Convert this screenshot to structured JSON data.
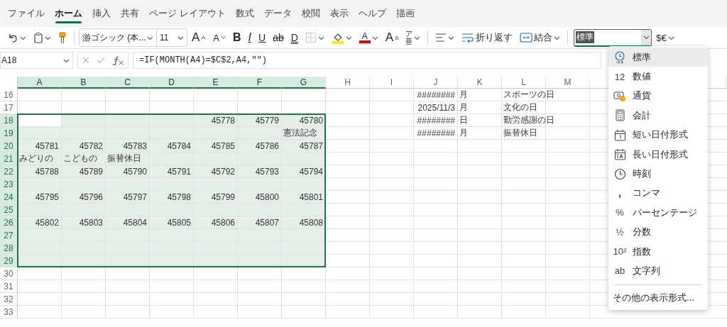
{
  "ribbon_tabs": [
    {
      "label": "ファイル",
      "selected": false
    },
    {
      "label": "ホーム",
      "selected": true
    },
    {
      "label": "挿入",
      "selected": false
    },
    {
      "label": "共有",
      "selected": false
    },
    {
      "label": "ページ レイアウト",
      "selected": false
    },
    {
      "label": "数式",
      "selected": false
    },
    {
      "label": "データ",
      "selected": false
    },
    {
      "label": "校閲",
      "selected": false
    },
    {
      "label": "表示",
      "selected": false
    },
    {
      "label": "ヘルプ",
      "selected": false
    },
    {
      "label": "描画",
      "selected": false
    }
  ],
  "toolbar": {
    "font": "游ゴシック (本...",
    "font_size": "11",
    "grow_font": "A",
    "shrink_font": "A",
    "bold": "B",
    "italic": "I",
    "underline": "U",
    "strikethrough": "ab",
    "double_underline": "D",
    "font_color": "A",
    "superscript_base": "A",
    "superscript_mark": "a",
    "phonetic_top": "ア",
    "phonetic_bottom": "亜",
    "wrap": "折り返す",
    "merge": "結合",
    "number_format": "標準",
    "currency": "$€"
  },
  "formula_bar": {
    "name_box": "A18",
    "formula": "=IF(MONTH(A4)=$C$2,A4,\"\")"
  },
  "sheet": {
    "columns": [
      {
        "label": "A",
        "selected": true
      },
      {
        "label": "B",
        "selected": true
      },
      {
        "label": "C",
        "selected": true
      },
      {
        "label": "D",
        "selected": true
      },
      {
        "label": "E",
        "selected": true
      },
      {
        "label": "F",
        "selected": true
      },
      {
        "label": "G",
        "selected": true
      },
      {
        "label": "H",
        "selected": false
      },
      {
        "label": "I",
        "selected": false
      },
      {
        "label": "J",
        "selected": false
      },
      {
        "label": "K",
        "selected": false
      },
      {
        "label": "L",
        "selected": false
      },
      {
        "label": "M",
        "selected": false
      }
    ],
    "rows": [
      {
        "number": "16",
        "selected": false,
        "cells": [
          {},
          {},
          {},
          {},
          {},
          {},
          {},
          {},
          {},
          {
            "text": "########",
            "kind": "number"
          },
          {
            "text": "月",
            "kind": "text"
          },
          {
            "text": "スポーツの日",
            "kind": "text"
          },
          {}
        ]
      },
      {
        "number": "17",
        "selected": false,
        "cells": [
          {},
          {},
          {},
          {},
          {},
          {},
          {},
          {},
          {},
          {
            "text": "2025/11/3",
            "kind": "number"
          },
          {
            "text": "月",
            "kind": "text"
          },
          {
            "text": "文化の日",
            "kind": "text"
          },
          {}
        ]
      },
      {
        "number": "18",
        "selected": true,
        "cells": [
          {
            "active": true
          },
          {},
          {},
          {},
          {
            "text": "45778",
            "kind": "number"
          },
          {
            "text": "45779",
            "kind": "number"
          },
          {
            "text": "45780",
            "kind": "number"
          },
          {},
          {},
          {
            "text": "########",
            "kind": "number"
          },
          {
            "text": "日",
            "kind": "text"
          },
          {
            "text": "勤労感謝の日",
            "kind": "text"
          },
          {}
        ]
      },
      {
        "number": "19",
        "selected": true,
        "cells": [
          {},
          {},
          {},
          {},
          {},
          {},
          {
            "text": "憲法記念",
            "kind": "text"
          },
          {},
          {},
          {
            "text": "########",
            "kind": "number"
          },
          {
            "text": "月",
            "kind": "text"
          },
          {
            "text": "振替休日",
            "kind": "text"
          },
          {}
        ]
      },
      {
        "number": "20",
        "selected": true,
        "cells": [
          {
            "text": "45781",
            "kind": "number"
          },
          {
            "text": "45782",
            "kind": "number"
          },
          {
            "text": "45783",
            "kind": "number"
          },
          {
            "text": "45784",
            "kind": "number"
          },
          {
            "text": "45785",
            "kind": "number"
          },
          {
            "text": "45786",
            "kind": "number"
          },
          {
            "text": "45787",
            "kind": "number"
          },
          {},
          {},
          {},
          {},
          {},
          {}
        ]
      },
      {
        "number": "21",
        "selected": true,
        "cells": [
          {
            "text": "みどりの",
            "kind": "text"
          },
          {
            "text": "こどもの",
            "kind": "text"
          },
          {
            "text": "振替休日",
            "kind": "text"
          },
          {},
          {},
          {},
          {},
          {},
          {},
          {},
          {},
          {},
          {}
        ]
      },
      {
        "number": "22",
        "selected": true,
        "cells": [
          {
            "text": "45788",
            "kind": "number"
          },
          {
            "text": "45789",
            "kind": "number"
          },
          {
            "text": "45790",
            "kind": "number"
          },
          {
            "text": "45791",
            "kind": "number"
          },
          {
            "text": "45792",
            "kind": "number"
          },
          {
            "text": "45793",
            "kind": "number"
          },
          {
            "text": "45794",
            "kind": "number"
          },
          {},
          {},
          {},
          {},
          {},
          {}
        ]
      },
      {
        "number": "23",
        "selected": true,
        "cells": [
          {},
          {},
          {},
          {},
          {},
          {},
          {},
          {},
          {},
          {},
          {},
          {},
          {}
        ]
      },
      {
        "number": "24",
        "selected": true,
        "cells": [
          {
            "text": "45795",
            "kind": "number"
          },
          {
            "text": "45796",
            "kind": "number"
          },
          {
            "text": "45797",
            "kind": "number"
          },
          {
            "text": "45798",
            "kind": "number"
          },
          {
            "text": "45799",
            "kind": "number"
          },
          {
            "text": "45800",
            "kind": "number"
          },
          {
            "text": "45801",
            "kind": "number"
          },
          {},
          {},
          {},
          {},
          {},
          {}
        ]
      },
      {
        "number": "25",
        "selected": true,
        "cells": [
          {},
          {},
          {},
          {},
          {},
          {},
          {},
          {},
          {},
          {},
          {},
          {},
          {}
        ]
      },
      {
        "number": "26",
        "selected": true,
        "cells": [
          {
            "text": "45802",
            "kind": "number"
          },
          {
            "text": "45803",
            "kind": "number"
          },
          {
            "text": "45804",
            "kind": "number"
          },
          {
            "text": "45805",
            "kind": "number"
          },
          {
            "text": "45806",
            "kind": "number"
          },
          {
            "text": "45807",
            "kind": "number"
          },
          {
            "text": "45808",
            "kind": "number"
          },
          {},
          {},
          {},
          {},
          {},
          {}
        ]
      },
      {
        "number": "27",
        "selected": true,
        "cells": [
          {},
          {},
          {},
          {},
          {},
          {},
          {},
          {},
          {},
          {},
          {},
          {},
          {}
        ]
      },
      {
        "number": "28",
        "selected": true,
        "cells": [
          {},
          {},
          {},
          {},
          {},
          {},
          {},
          {},
          {},
          {},
          {},
          {},
          {}
        ]
      },
      {
        "number": "29",
        "selected": true,
        "cells": [
          {},
          {},
          {},
          {},
          {},
          {},
          {},
          {},
          {},
          {},
          {},
          {},
          {}
        ]
      },
      {
        "number": "30",
        "selected": false,
        "cells": [
          {},
          {},
          {},
          {},
          {},
          {},
          {},
          {},
          {},
          {},
          {},
          {},
          {}
        ]
      },
      {
        "number": "31",
        "selected": false,
        "cells": [
          {},
          {},
          {},
          {},
          {},
          {},
          {},
          {},
          {},
          {},
          {},
          {},
          {}
        ]
      },
      {
        "number": "32",
        "selected": false,
        "cells": [
          {},
          {},
          {},
          {},
          {},
          {},
          {},
          {},
          {},
          {},
          {},
          {},
          {}
        ]
      },
      {
        "number": "33",
        "selected": false,
        "cells": [
          {},
          {},
          {},
          {},
          {},
          {},
          {},
          {},
          {},
          {},
          {},
          {},
          {}
        ]
      }
    ]
  },
  "format_menu": {
    "items": [
      {
        "kind": "general",
        "label": "標準",
        "selected": true
      },
      {
        "kind": "number",
        "glyph": "12",
        "label": "数値",
        "selected": false
      },
      {
        "kind": "currency",
        "label": "通貨",
        "selected": false
      },
      {
        "kind": "accounting",
        "label": "会計",
        "selected": false
      },
      {
        "kind": "short-date",
        "label": "短い日付形式",
        "selected": false
      },
      {
        "kind": "long-date",
        "label": "長い日付形式",
        "selected": false
      },
      {
        "kind": "time",
        "label": "時刻",
        "selected": false
      },
      {
        "kind": "comma",
        "glyph": ",",
        "label": "コンマ",
        "selected": false
      },
      {
        "kind": "percent",
        "glyph": "%",
        "label": "パーセンテージ",
        "selected": false
      },
      {
        "kind": "fraction",
        "glyph": "½",
        "label": "分数",
        "selected": false
      },
      {
        "kind": "scientific",
        "glyph": "10²",
        "label": "指数",
        "selected": false
      },
      {
        "kind": "text",
        "glyph": "ab",
        "label": "文字列",
        "selected": false
      }
    ],
    "footer": "その他の表示形式..."
  }
}
